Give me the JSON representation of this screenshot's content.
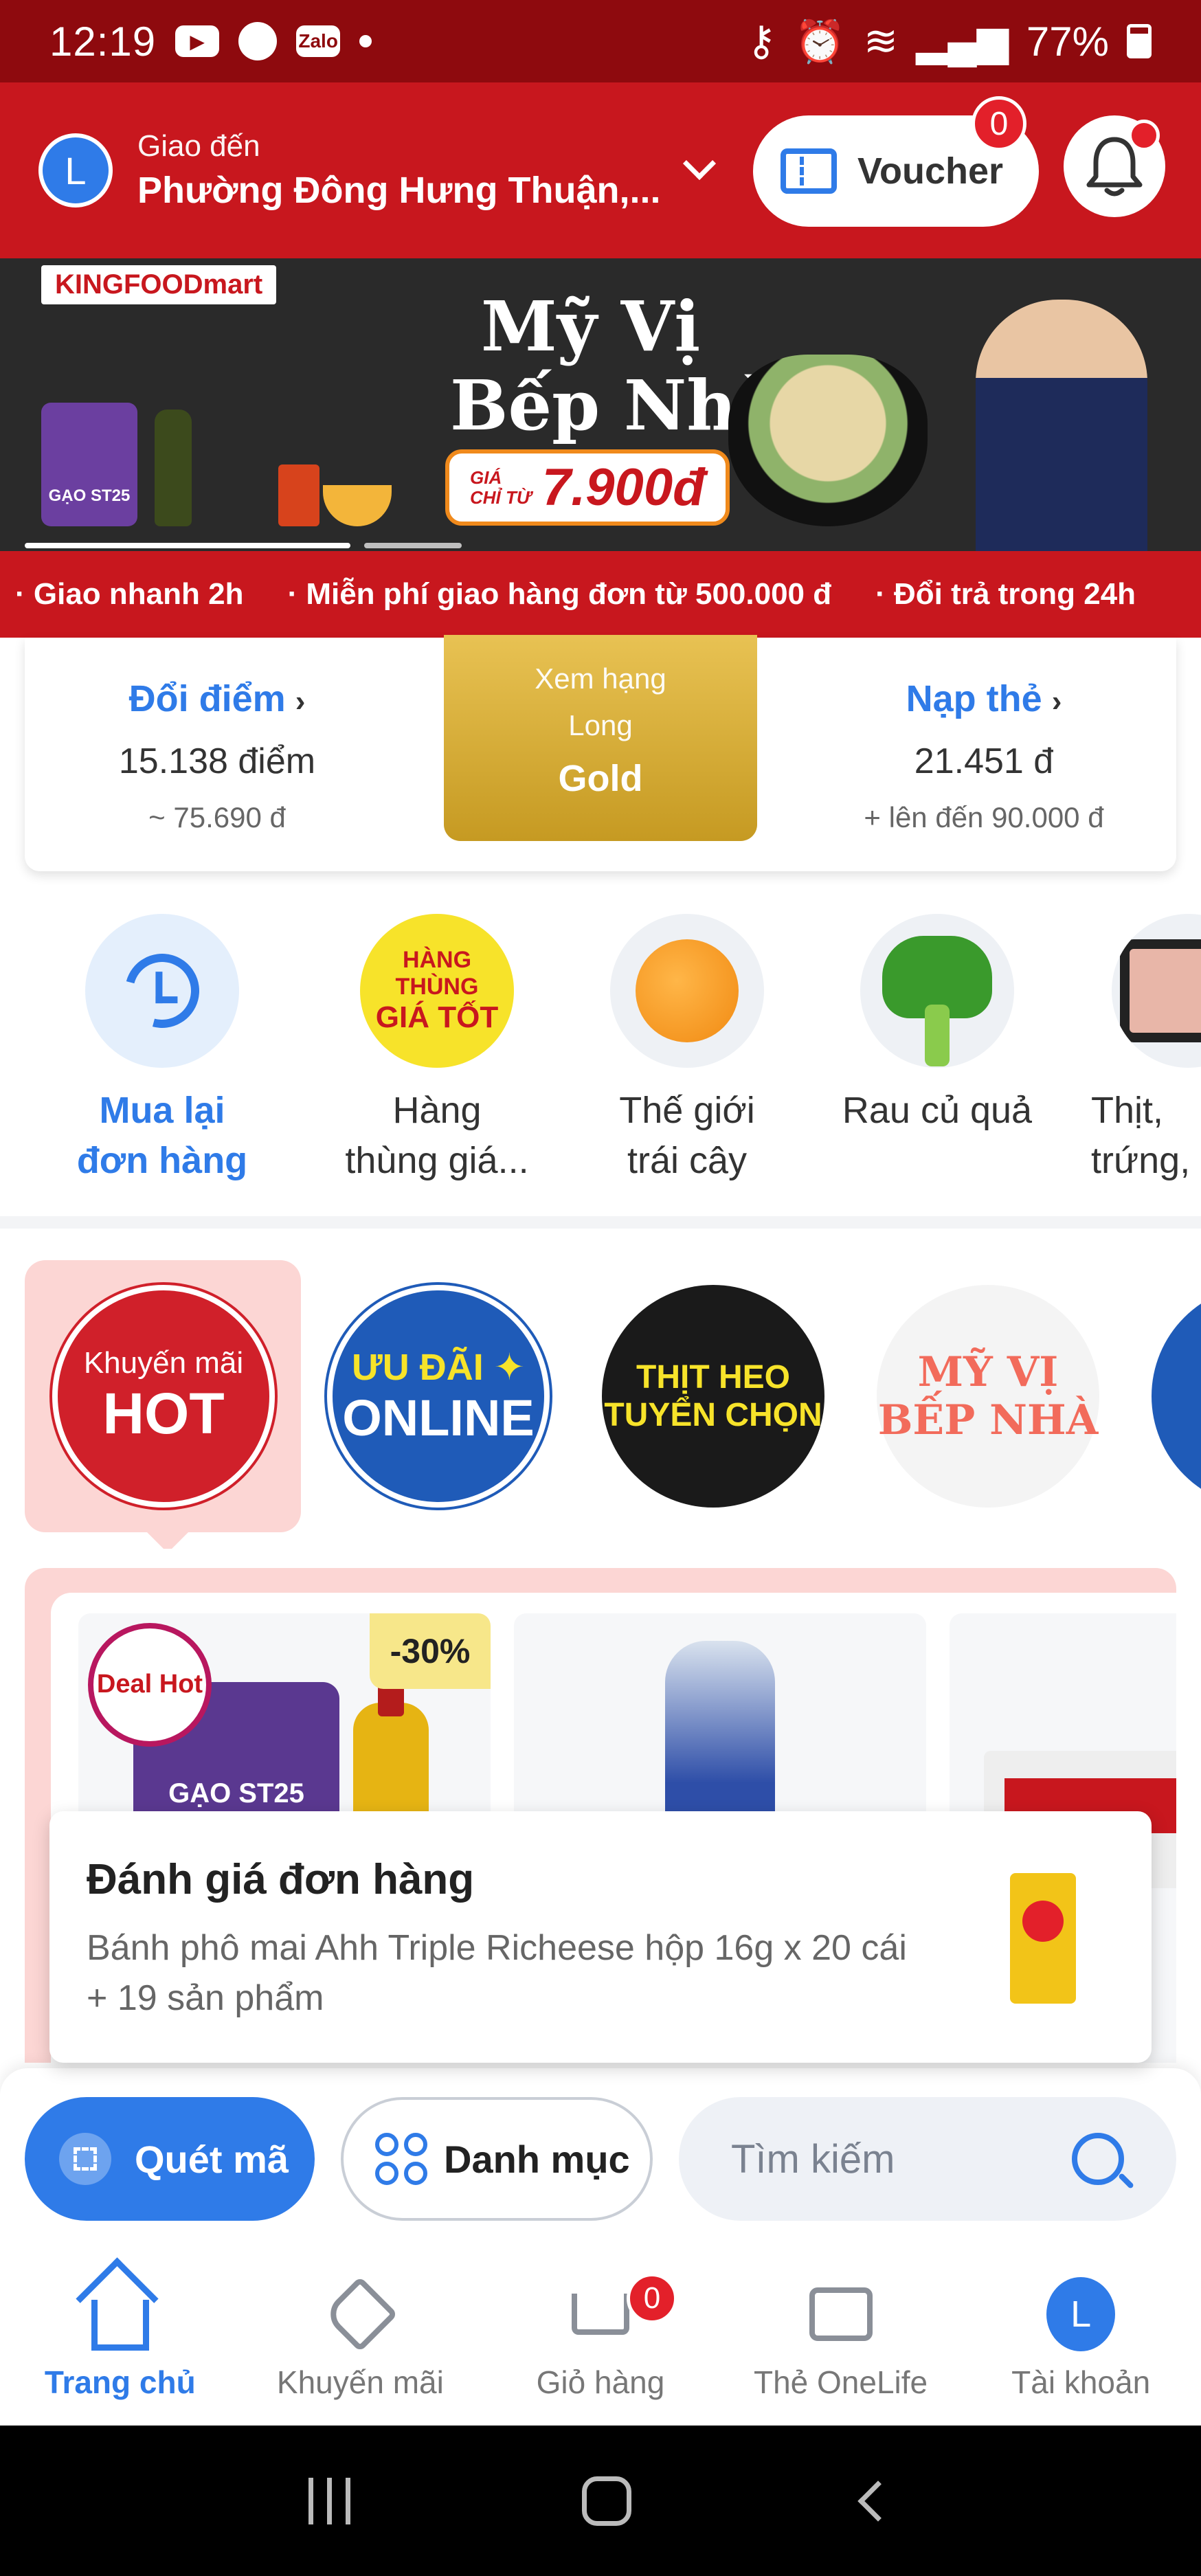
{
  "status_bar": {
    "time": "12:19",
    "battery": "77%",
    "app_icons": [
      "youtube-icon",
      "soccer-icon",
      "zalo-icon"
    ],
    "zalo_label": "Zalo"
  },
  "header": {
    "avatar_initial": "L",
    "delivery_label": "Giao đến",
    "address": "Phường Đông Hưng Thuận,...",
    "voucher_label": "Voucher",
    "voucher_count": "0"
  },
  "banner": {
    "brand": "KINGFOODmart",
    "title_line1": "Mỹ Vị",
    "title_line2": "Bếp Nhà",
    "price_prefix_1": "GIÁ",
    "price_prefix_2": "CHỈ TỪ",
    "price": "7.900đ",
    "rice_label": "GẠO ST25",
    "slide_count": 2,
    "active_slide": 1
  },
  "promo_strip": {
    "items": [
      "· Giao nhanh 2h",
      "· Miễn phí giao hàng đơn từ 500.000 đ",
      "· Đổi trả trong 24h"
    ]
  },
  "points": {
    "redeem": {
      "title": "Đổi điểm",
      "value": "15.138 điểm",
      "sub": "~ 75.690 đ"
    },
    "tier": {
      "line1": "Xem hạng",
      "line2": "Long",
      "line3": "Gold"
    },
    "topup": {
      "title": "Nạp thẻ",
      "value": "21.451 đ",
      "sub": "+ lên đến 90.000 đ"
    }
  },
  "categories": [
    {
      "line1": "Mua lại",
      "line2": "đơn hàng",
      "icon": "history-icon"
    },
    {
      "line1": "Hàng",
      "line2": "thùng giá...",
      "icon": "hang-thung-icon",
      "badge_line1": "HÀNG THÙNG",
      "badge_line2": "GIÁ TỐT"
    },
    {
      "line1": "Thế giới",
      "line2": "trái cây",
      "icon": "orange-icon"
    },
    {
      "line1": "Rau củ quả",
      "line2": "",
      "icon": "broccoli-icon"
    },
    {
      "line1": "Thịt,",
      "line2": "trứng,",
      "icon": "meat-icon"
    }
  ],
  "collections": [
    {
      "line1": "Khuyến mãi",
      "line2": "HOT"
    },
    {
      "line1": "ƯU ĐÃI ✦",
      "line2": "ONLINE"
    },
    {
      "line1": "THỊT HEO",
      "line2": "TUYỂN CHỌN"
    },
    {
      "line1": "MỸ VỊ",
      "line2": "BẾP NHÀ"
    }
  ],
  "products": {
    "deal_badge": "Deal Hot",
    "discount": "-30%",
    "rice_label": "GẠO ST25"
  },
  "review_toast": {
    "title": "Đánh giá đơn hàng",
    "description": "Bánh phô mai Ahh Triple Richeese hộp 16g x 20 cái + 19 sản phẩm"
  },
  "action_bar": {
    "scan_label": "Quét mã",
    "category_label": "Danh mục",
    "search_placeholder": "Tìm kiếm"
  },
  "bottom_nav": {
    "items": [
      {
        "label": "Trang chủ",
        "icon": "home-icon",
        "active": true
      },
      {
        "label": "Khuyến mãi",
        "icon": "tag-icon"
      },
      {
        "label": "Giỏ hàng",
        "icon": "cart-icon",
        "badge": "0"
      },
      {
        "label": "Thẻ OneLife",
        "icon": "wallet-icon"
      },
      {
        "label": "Tài khoản",
        "icon": "account-icon",
        "initial": "L"
      }
    ]
  },
  "colors": {
    "brand_red": "#c8171e",
    "status_red": "#8e0a0e",
    "accent_blue": "#2f7be8",
    "gold": "#d4a92e"
  }
}
